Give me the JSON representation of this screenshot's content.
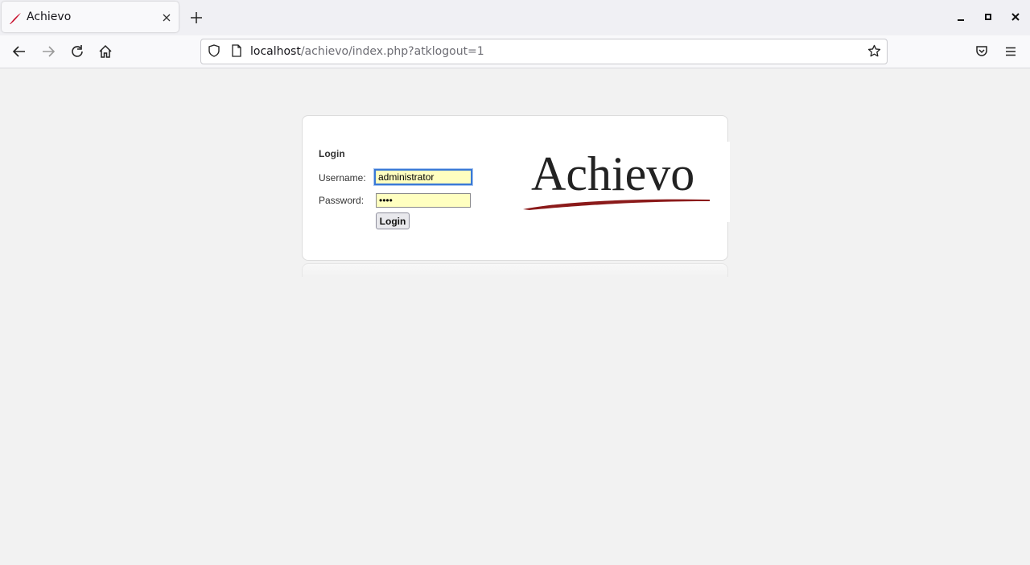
{
  "browser": {
    "tab": {
      "title": "Achievo",
      "favicon": "achievo-feather-icon"
    },
    "address": {
      "host": "localhost",
      "path": "/achievo/index.php?atklogout=1"
    },
    "icons": {
      "back": "back-arrow-icon",
      "forward": "forward-arrow-icon",
      "reload": "reload-icon",
      "home": "home-icon",
      "shield": "tracking-protection-shield-icon",
      "page": "page-info-icon",
      "bookmark": "bookmark-star-icon",
      "pocket": "pocket-icon",
      "menu": "hamburger-menu-icon"
    }
  },
  "login": {
    "heading": "Login",
    "username_label": "Username:",
    "username_value": "administrator",
    "password_label": "Password:",
    "password_value": "••••",
    "button_label": "Login"
  },
  "logo": {
    "text": "Achievo",
    "swoosh_color": "#8b1a1a"
  },
  "colors": {
    "input_background": "#ffffc0",
    "page_background": "#f2f2f2",
    "focus_ring": "#3a79d6"
  }
}
